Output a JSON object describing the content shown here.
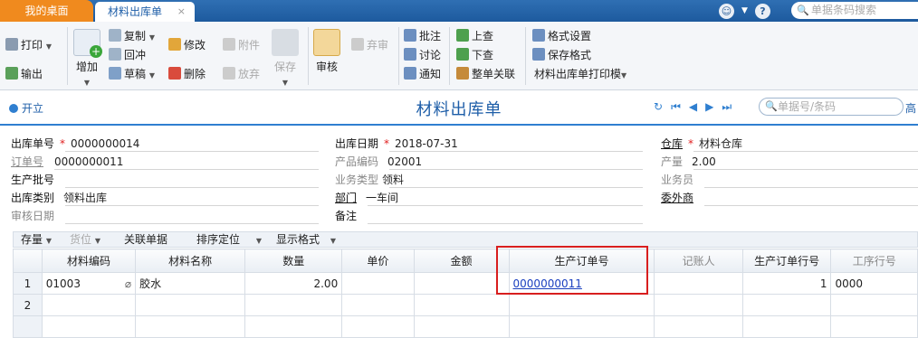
{
  "tabs": {
    "home": "我的桌面",
    "active": "材料出库单",
    "close": "×"
  },
  "top": {
    "search_placeholder": "单据条码搜索",
    "help": "?"
  },
  "ribbon": {
    "print": "打印",
    "export": "输出",
    "add": "增加",
    "copy": "复制",
    "reverse": "回冲",
    "draft": "草稿",
    "modify": "修改",
    "attach": "附件",
    "delete": "删除",
    "abandon": "放弃",
    "save": "保存",
    "audit": "审核",
    "unaudit": "弃审",
    "annotate": "批注",
    "discuss": "讨论",
    "notify": "通知",
    "up": "上查",
    "down": "下查",
    "related": "整单关联",
    "format": "格式设置",
    "save_format": "保存格式",
    "print_template": "材料出库单打印模"
  },
  "titlebar": {
    "open": "开立",
    "title": "材料出库单",
    "search_placeholder": "单据号/条码",
    "more": "高"
  },
  "header": {
    "out_no": {
      "label": "出库单号",
      "value": "0000000014"
    },
    "order_no": {
      "label": "订单号",
      "value": "0000000011"
    },
    "prod_batch": {
      "label": "生产批号",
      "value": ""
    },
    "out_type": {
      "label": "出库类别",
      "value": "领料出库"
    },
    "audit_date": {
      "label": "审核日期",
      "value": ""
    },
    "out_date": {
      "label": "出库日期",
      "value": "2018-07-31"
    },
    "prod_code": {
      "label": "产品编码",
      "value": "02001"
    },
    "biz_type": {
      "label": "业务类型",
      "value": "领料"
    },
    "dept": {
      "label": "部门",
      "value": "一车间"
    },
    "remark": {
      "label": "备注",
      "value": ""
    },
    "warehouse": {
      "label": "仓库",
      "value": "材料仓库"
    },
    "output": {
      "label": "产量",
      "value": "2.00"
    },
    "salesman": {
      "label": "业务员",
      "value": ""
    },
    "outsource": {
      "label": "委外商",
      "value": ""
    }
  },
  "grid_toolbar": {
    "stock": "存量",
    "location": "货位",
    "related": "关联单据",
    "sort": "排序定位",
    "display": "显示格式"
  },
  "grid": {
    "columns": [
      "材料编码",
      "材料名称",
      "数量",
      "单价",
      "金额",
      "生产订单号",
      "记账人",
      "生产订单行号",
      "工序行号"
    ],
    "rows": [
      {
        "num": "1",
        "code": "01003",
        "name": "胶水",
        "qty": "2.00",
        "price": "",
        "amount": "",
        "order": "0000000011",
        "bookkeeper": "",
        "line": "1",
        "proc": "0000"
      },
      {
        "num": "2",
        "code": "",
        "name": "",
        "qty": "",
        "price": "",
        "amount": "",
        "order": "",
        "bookkeeper": "",
        "line": "",
        "proc": ""
      },
      {
        "num": "",
        "code": "",
        "name": "",
        "qty": "",
        "price": "",
        "amount": "",
        "order": "",
        "bookkeeper": "",
        "line": "",
        "proc": ""
      }
    ]
  },
  "colors": {
    "highlight_box": "#d81e1e",
    "accent": "#1e5ea8",
    "home_tab": "#f08a1e"
  }
}
